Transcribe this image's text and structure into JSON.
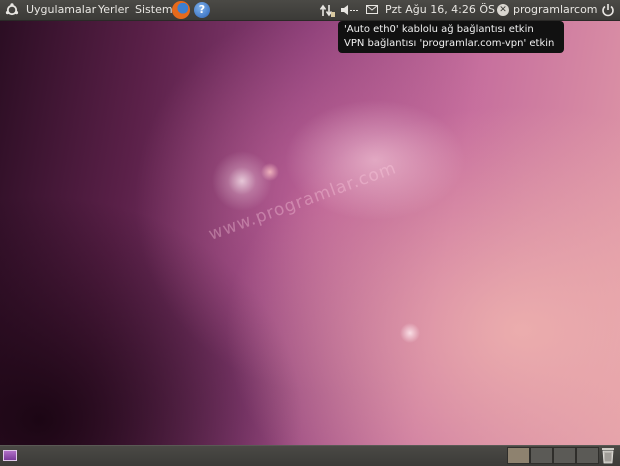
{
  "top_panel": {
    "menus": [
      "Uygulamalar",
      "Yerler",
      "Sistem"
    ],
    "icons": {
      "ubuntu": "ubuntu-logo-icon",
      "browser": "firefox-icon",
      "help": "help-icon",
      "network": "network-icon",
      "volume": "volume-icon",
      "mail": "mail-icon",
      "status": "user-status-icon",
      "power": "power-icon"
    },
    "clock": "Pzt Ağu 16,  4:26 ÖS",
    "username": "programlarcom"
  },
  "notification": {
    "line1": "'Auto eth0' kablolu ağ bağlantısı etkin",
    "line2": "VPN bağlantısı 'programlar.com-vpn' etkin"
  },
  "desktop": {
    "watermark": "www.programlar.com"
  },
  "bottom_panel": {
    "workspaces": 4,
    "active_workspace": 1,
    "icons": {
      "show_desktop": "show-desktop-icon",
      "trash": "trash-icon"
    }
  },
  "colors": {
    "panel": "#3f3e3a",
    "panel_text": "#e8e6e2",
    "tooltip_bg": "#111111",
    "wallpaper_accent": "#8c3f78"
  }
}
